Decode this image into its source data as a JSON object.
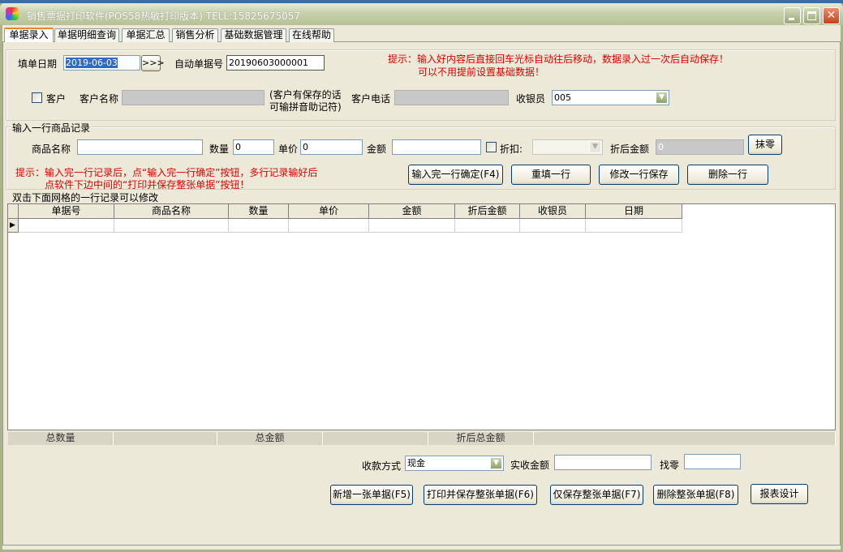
{
  "window": {
    "title": "销售票据打印软件(POS58热敏打印版本) TELL:15825675057",
    "close": "✕"
  },
  "tabs": [
    "单据录入",
    "单据明细查询",
    "单据汇总",
    "销售分析",
    "基础数据管理",
    "在线帮助"
  ],
  "header": {
    "date_label": "填单日期",
    "date_value": "2019-06-03",
    "date_button": ">>>",
    "auto_no_label": "自动单据号",
    "auto_no_value": "20190603000001",
    "hint1": "提示：输入好内容后直接回车光标自动往后移动，数据录入过一次后自动保存！",
    "hint2": "可以不用提前设置基础数据！",
    "customer_check": "客户",
    "customer_name_label": "客户名称",
    "customer_note1": "(客户有保存的话",
    "customer_note2": "可输拼音助记符)",
    "customer_phone_label": "客户电话",
    "cashier_label": "收银员",
    "cashier_value": "005"
  },
  "entry": {
    "group_title": "输入一行商品记录",
    "product_label": "商品名称",
    "qty_label": "数量",
    "qty_value": "0",
    "price_label": "单价",
    "price_value": "0",
    "amount_label": "金额",
    "discount_label": "折扣:",
    "discounted_label": "折后金额",
    "discounted_value": "0",
    "round_button": "抹零",
    "hint1": "提示：输入完一行记录后，点“输入完一行确定”按钮，多行记录输好后",
    "hint2": "点软件下边中间的“打印并保存整张单据”按钮！",
    "buttons": [
      "输入完一行确定(F4)",
      "重填一行",
      "修改一行保存",
      "删除一行"
    ]
  },
  "grid": {
    "group_title": "双击下面网格的一行记录可以修改",
    "columns": [
      "单据号",
      "商品名称",
      "数量",
      "单价",
      "金额",
      "折后金额",
      "收银员",
      "日期"
    ],
    "summary": [
      "总数量",
      "总金额",
      "折后总金额"
    ]
  },
  "payment": {
    "method_label": "收款方式",
    "method_value": "现金",
    "received_label": "实收金额",
    "change_label": "找零"
  },
  "actions": [
    "新增一张单据(F5)",
    "打印并保存整张单据(F6)",
    "仅保存整张单据(F7)",
    "删除整张单据(F8)",
    "报表设计"
  ]
}
